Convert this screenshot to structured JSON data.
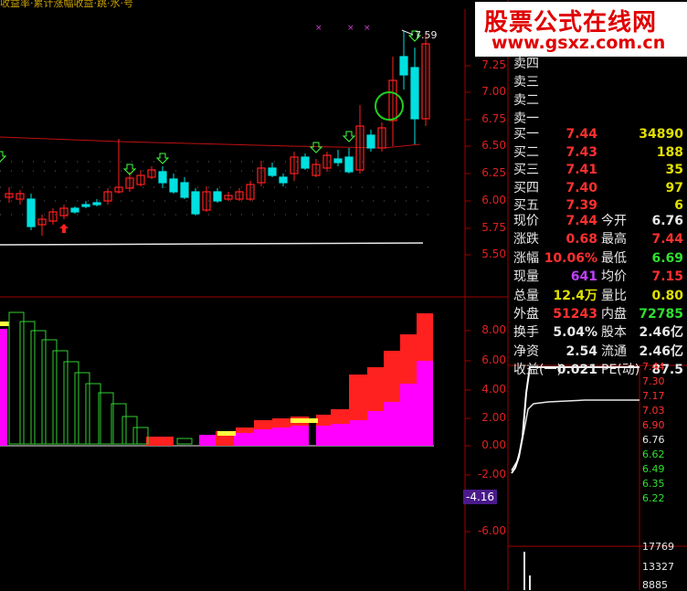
{
  "title_text": "收益率·累计涨幅收益·跳·水·号",
  "watermark": {
    "line1": "股票公式在线网",
    "line2": "www.gsxz.com.cn"
  },
  "main_chart": {
    "high_label": "7.59",
    "y_ticks": [
      "7.25",
      "7.00",
      "6.75",
      "6.50",
      "6.25",
      "6.00",
      "5.75",
      "5.50"
    ]
  },
  "sell_book": [
    "卖四",
    "卖三",
    "卖二",
    "卖一"
  ],
  "buy_book": [
    {
      "label": "买一",
      "price": "7.44",
      "vol": "34890"
    },
    {
      "label": "买二",
      "price": "7.43",
      "vol": "188"
    },
    {
      "label": "买三",
      "price": "7.41",
      "vol": "35"
    },
    {
      "label": "买四",
      "price": "7.40",
      "vol": "97"
    },
    {
      "label": "买五",
      "price": "7.39",
      "vol": "6"
    }
  ],
  "stats": [
    {
      "l1": "现价",
      "v1": "7.44",
      "c1": "#ff3030",
      "l2": "今开",
      "v2": "6.76",
      "c2": "#e8e8e8"
    },
    {
      "l1": "涨跌",
      "v1": "0.68",
      "c1": "#ff3030",
      "l2": "最高",
      "v2": "7.44",
      "c2": "#ff3030"
    },
    {
      "l1": "涨幅",
      "v1": "10.06%",
      "c1": "#ff3030",
      "l2": "最低",
      "v2": "6.69",
      "c2": "#30e030"
    },
    {
      "l1": "现量",
      "v1": "641",
      "c1": "#c040ff",
      "l2": "均价",
      "v2": "7.15",
      "c2": "#ff3030"
    },
    {
      "l1": "总量",
      "v1": "12.4万",
      "c1": "#e0e000",
      "l2": "量比",
      "v2": "0.80",
      "c2": "#e0e000"
    },
    {
      "l1": "外盘",
      "v1": "51243",
      "c1": "#ff3030",
      "l2": "内盘",
      "v2": "72785",
      "c2": "#30e030"
    },
    {
      "l1": "换手",
      "v1": "5.04%",
      "c1": "#e8e8e8",
      "l2": "股本",
      "v2": "2.46亿",
      "c2": "#e8e8e8"
    },
    {
      "l1": "净资",
      "v1": "2.54",
      "c1": "#e8e8e8",
      "l2": "流通",
      "v2": "2.46亿",
      "c2": "#e8e8e8"
    },
    {
      "l1": "收益(一)",
      "v1": "0.021",
      "c1": "#e8e8e8",
      "l2": "PE(动)",
      "v2": "87.5",
      "c2": "#e8e8e8"
    }
  ],
  "indicator": {
    "y_ticks": [
      "8.00",
      "6.00",
      "4.00",
      "2.00",
      "0.00",
      "-2.00",
      "-4.16",
      "-6.00"
    ],
    "current_value": "-4.16"
  },
  "intraday": {
    "price_ticks": [
      "7.44",
      "7.30",
      "7.17",
      "7.03",
      "6.90",
      "6.76",
      "6.62",
      "6.49",
      "6.35",
      "6.22"
    ],
    "vol_ticks": [
      "17769",
      "13327",
      "8885"
    ]
  },
  "colors": {
    "up": "#ff2020",
    "down": "#00e0e0",
    "magenta": "#ff00ff",
    "yellow": "#ffff40",
    "green_arrow": "#40ff40"
  }
}
